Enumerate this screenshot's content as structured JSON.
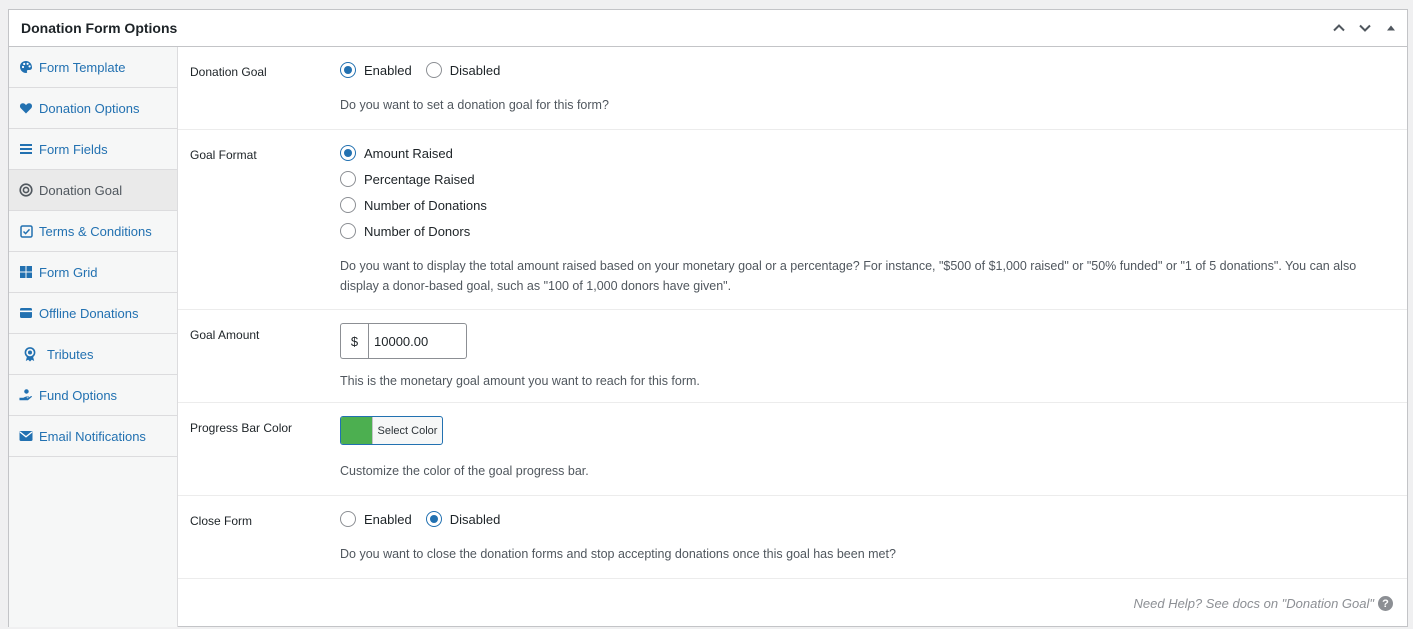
{
  "panel": {
    "title": "Donation Form Options"
  },
  "header_controls": {
    "up_icon": "chevron-up-icon",
    "down_icon": "chevron-down-icon",
    "toggle_icon": "triangle-up-icon"
  },
  "sidebar": {
    "items": [
      {
        "label": "Form Template",
        "icon": "palette-icon"
      },
      {
        "label": "Donation Options",
        "icon": "heart-icon"
      },
      {
        "label": "Form Fields",
        "icon": "list-icon"
      },
      {
        "label": "Donation Goal",
        "icon": "target-icon"
      },
      {
        "label": "Terms & Conditions",
        "icon": "checkbox-icon"
      },
      {
        "label": "Form Grid",
        "icon": "grid-icon"
      },
      {
        "label": "Offline Donations",
        "icon": "credit-card-icon"
      },
      {
        "label": "Tributes",
        "icon": "award-icon"
      },
      {
        "label": "Fund Options",
        "icon": "hand-coin-icon"
      },
      {
        "label": "Email Notifications",
        "icon": "envelope-icon"
      }
    ],
    "active": "Donation Goal"
  },
  "fields": {
    "donation_goal": {
      "label": "Donation Goal",
      "options": [
        "Enabled",
        "Disabled"
      ],
      "selected": "Enabled",
      "description": "Do you want to set a donation goal for this form?"
    },
    "goal_format": {
      "label": "Goal Format",
      "options": [
        "Amount Raised",
        "Percentage Raised",
        "Number of Donations",
        "Number of Donors"
      ],
      "selected": "Amount Raised",
      "description": "Do you want to display the total amount raised based on your monetary goal or a percentage? For instance, \"$500 of $1,000 raised\" or \"50% funded\" or \"1 of 5 donations\". You can also display a donor-based goal, such as \"100 of 1,000 donors have given\"."
    },
    "goal_amount": {
      "label": "Goal Amount",
      "currency": "$",
      "value": "10000.00",
      "description": "This is the monetary goal amount you want to reach for this form."
    },
    "progress_bar_color": {
      "label": "Progress Bar Color",
      "button_label": "Select Color",
      "color": "#4caf50",
      "description": "Customize the color of the goal progress bar."
    },
    "close_form": {
      "label": "Close Form",
      "options": [
        "Enabled",
        "Disabled"
      ],
      "selected": "Disabled",
      "description": "Do you want to close the donation forms and stop accepting donations once this goal has been met?"
    }
  },
  "help": {
    "text": "Need Help? See docs on \"Donation Goal\"",
    "icon": "question-circle-icon"
  }
}
